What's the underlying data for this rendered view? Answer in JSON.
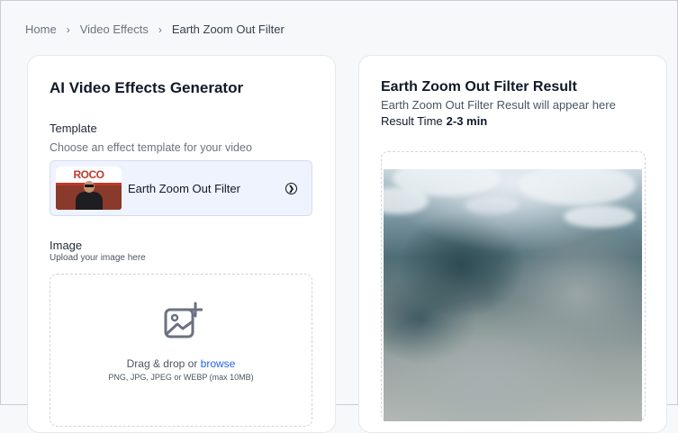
{
  "breadcrumb": {
    "home": "Home",
    "section": "Video Effects",
    "current": "Earth Zoom Out Filter"
  },
  "generator": {
    "title": "AI Video Effects Generator",
    "template_label": "Template",
    "template_hint": "Choose an effect template for your video",
    "selected_template": "Earth Zoom Out Filter",
    "thumbnail_sign_text": "ROCO",
    "image_label": "Image",
    "image_hint": "Upload your image here",
    "drop_text": "Drag & drop or",
    "browse_label": "browse",
    "formats": "PNG, JPG, JPEG or WEBP (max 10MB)"
  },
  "result": {
    "title": "Earth Zoom Out Filter Result",
    "hint": "Earth Zoom Out Filter Result will appear here",
    "time_label": "Result Time",
    "time_value": "2-3 min"
  },
  "icons": {
    "breadcrumb_separator": "chevron-right-icon",
    "template_action": "chevron-right-circle-icon",
    "upload": "image-plus-icon"
  },
  "colors": {
    "accent": "#2563eb",
    "template_bg": "#eef3fd",
    "page_bg": "#f7f8fa"
  }
}
